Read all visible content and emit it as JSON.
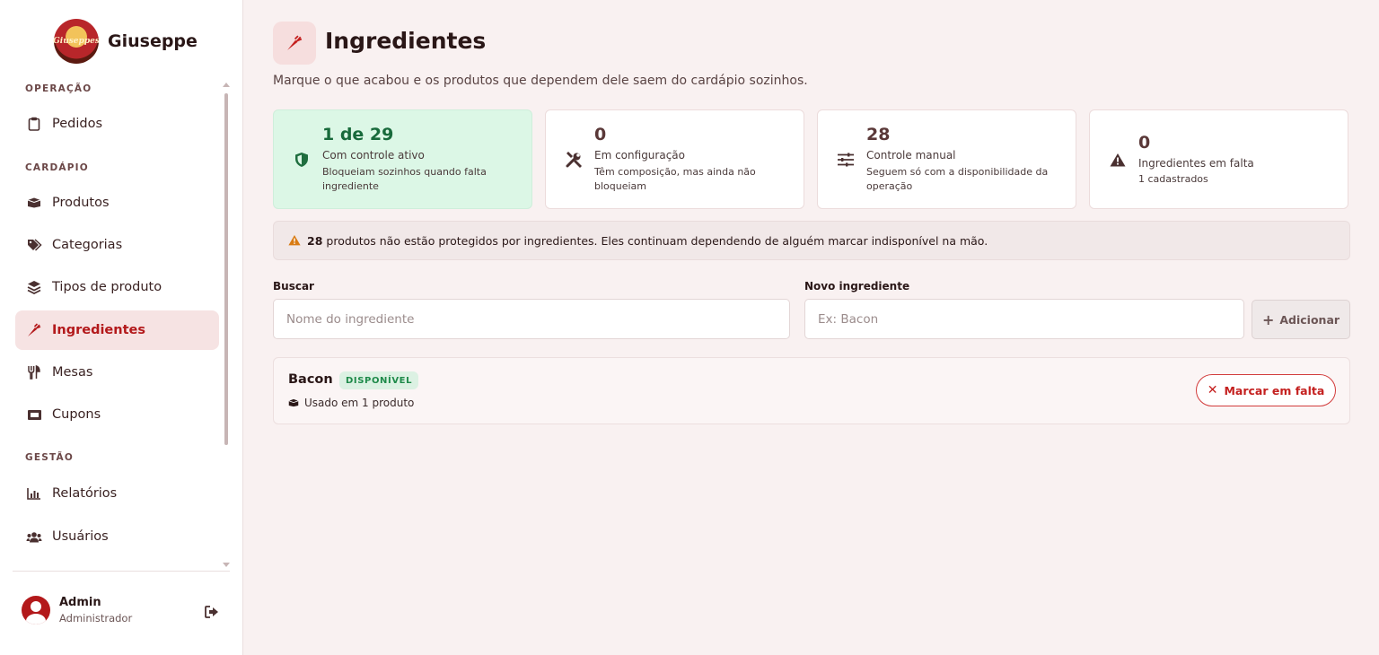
{
  "brand": {
    "name": "Giuseppe",
    "logo_text": "Giuseppes"
  },
  "sidebar": {
    "sections": [
      {
        "title": "OPERAÇÃO"
      },
      {
        "title": "CARDÁPIO"
      },
      {
        "title": "GESTÃO"
      }
    ],
    "items": [
      {
        "label": "Pedidos",
        "icon": "clipboard-icon"
      },
      {
        "label": "Produtos",
        "icon": "box-icon"
      },
      {
        "label": "Categorias",
        "icon": "tags-icon"
      },
      {
        "label": "Tipos de produto",
        "icon": "layers-icon"
      },
      {
        "label": "Ingredientes",
        "icon": "carrot-icon",
        "active": true
      },
      {
        "label": "Mesas",
        "icon": "utensils-icon"
      },
      {
        "label": "Cupons",
        "icon": "ticket-icon"
      },
      {
        "label": "Relatórios",
        "icon": "bar-chart-icon"
      },
      {
        "label": "Usuários",
        "icon": "users-icon"
      }
    ]
  },
  "user": {
    "name": "Admin",
    "role": "Administrador"
  },
  "header": {
    "title": "Ingredientes",
    "subtitle": "Marque o que acabou e os produtos que dependem dele saem do cardápio sozinhos."
  },
  "stats": [
    {
      "value": "1 de 29",
      "label": "Com controle ativo",
      "desc": "Bloqueiam sozinhos quando falta ingrediente",
      "icon": "shield-icon"
    },
    {
      "value": "0",
      "label": "Em configuração",
      "desc": "Têm composição, mas ainda não bloqueiam",
      "icon": "tools-icon"
    },
    {
      "value": "28",
      "label": "Controle manual",
      "desc": "Seguem só com a disponibilidade da operação",
      "icon": "sliders-icon"
    },
    {
      "value": "0",
      "label": "Ingredientes em falta",
      "desc": "1 cadastrados",
      "icon": "warning-icon"
    }
  ],
  "warning": {
    "count": "28",
    "text": "produtos não estão protegidos por ingredientes. Eles continuam dependendo de alguém marcar indisponível na mão."
  },
  "search": {
    "label": "Buscar",
    "placeholder": "Nome do ingrediente",
    "value": ""
  },
  "new_ingredient": {
    "label": "Novo ingrediente",
    "placeholder": "Ex: Bacon",
    "value": "",
    "add_label": "Adicionar"
  },
  "ingredients": [
    {
      "name": "Bacon",
      "status": "DISPONÍVEL",
      "usage": "Usado em 1 produto",
      "action": "Marcar em falta"
    }
  ],
  "colors": {
    "accent": "#b3191b",
    "success_bg": "#dcf7e6",
    "success_text": "#186a3b",
    "warning_icon": "#d97b13"
  }
}
